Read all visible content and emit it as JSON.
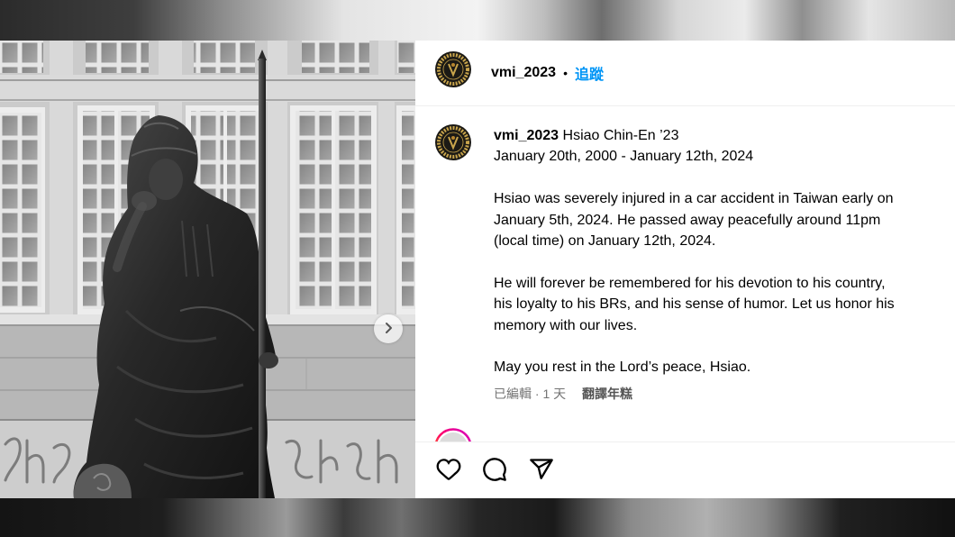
{
  "header": {
    "username": "vmi_2023",
    "separator": "•",
    "follow_label": "追蹤",
    "avatar_icon": "vmi-logo-avatar"
  },
  "caption": {
    "username": "vmi_2023",
    "title": "Hsiao Chin-En ’23",
    "dates": "January 20th, 2000 - January 12th, 2024",
    "paragraphs": [
      [
        "Hsiao was severely injured in a car accident in Taiwan early on",
        "January 5th, 2024. He passed away peacefully around 11pm",
        "(local time) on January 12th, 2024."
      ],
      [
        "He will forever be remembered for his devotion to his country,",
        "his loyalty to his BRs, and his sense of humor. Let us honor his",
        "memory with our lives."
      ],
      [
        "May you rest in the Lord’s peace, Hsiao."
      ]
    ],
    "meta": "已編輯 · 1 天",
    "translate_label": "翻譯年糕"
  },
  "media": {
    "next_icon": "chevron-right-icon",
    "photo": "grayscale-statue-photo"
  },
  "actions": {
    "like_icon": "heart-icon",
    "comment_icon": "comment-icon",
    "share_icon": "send-icon"
  },
  "colors": {
    "link": "#0095f6",
    "text": "#000000",
    "secondary_text": "#737373",
    "divider": "#efefef",
    "story_ring": "#d300c5"
  }
}
